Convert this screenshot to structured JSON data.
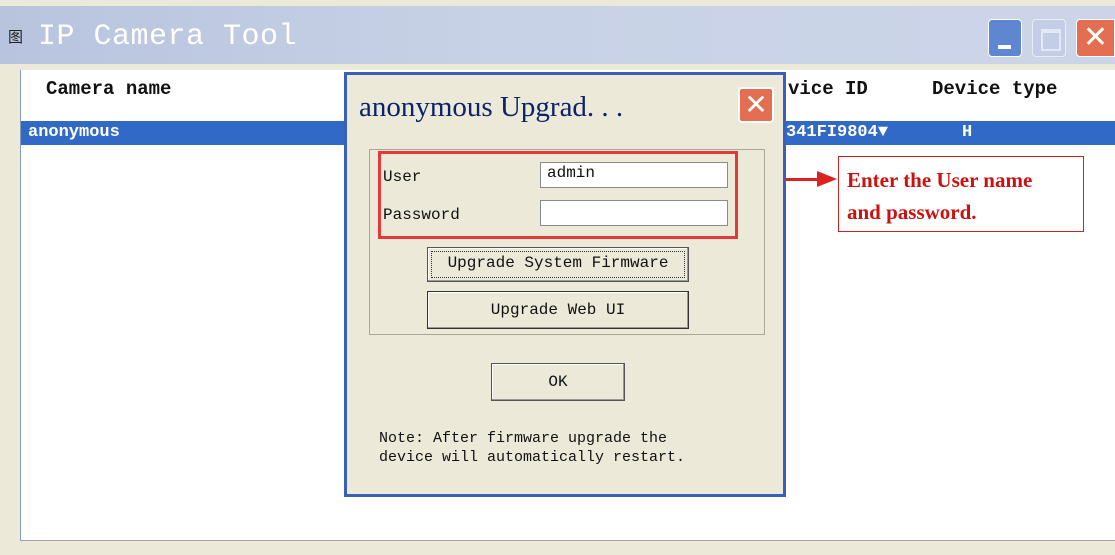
{
  "window": {
    "title": "IP Camera Tool",
    "icon": "app-icon",
    "icon_glyph": "图",
    "controls": {
      "minimize": "minimize",
      "maximize": "maximize",
      "close_glyph": "✕"
    }
  },
  "table": {
    "columns": [
      "Camera name",
      "vice ID",
      "Device type"
    ],
    "rows": [
      {
        "name": "anonymous",
        "device_id": "341FI9804▼",
        "device_type": "H"
      }
    ]
  },
  "dialog": {
    "title": "anonymous Upgrad. . .",
    "close_glyph": "✕",
    "user_label": "User",
    "user_value": "admin",
    "password_label": "Password",
    "password_value": "",
    "upgrade_firmware_button": "Upgrade System Firmware",
    "upgrade_webui_button": "Upgrade Web UI",
    "ok_button": "OK",
    "note": "Note: After firmware upgrade the\ndevice will automatically restart."
  },
  "annotation": {
    "text_line1": "Enter the User name",
    "text_line2": "and password.",
    "color": "#cc1111"
  },
  "colors": {
    "selection": "#3169c6",
    "dialog_border": "#3a5fb8",
    "highlight": "#e53939",
    "close_button": "#e46e52"
  }
}
